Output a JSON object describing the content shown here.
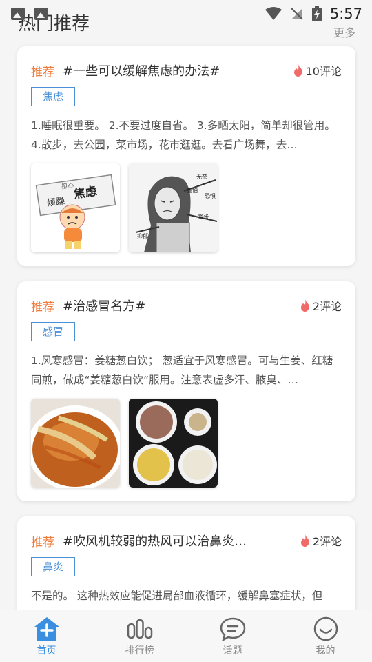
{
  "status_bar": {
    "time": "5:57"
  },
  "header": {
    "title": "热门推荐",
    "more": "更多"
  },
  "cards": [
    {
      "badge": "推荐",
      "topic": "#一些可以缓解焦虑的办法#",
      "comments": "10评论",
      "tag": "焦虑",
      "excerpt": "1.睡眠很重要。 2.不要过度自省。 3.多晒太阳，简单却很管用。 4.散步，去公园，菜市场，花市逛逛。去看广场舞，去…",
      "images": [
        {
          "lines": [
            "烦躁",
            "担心",
            "焦虑"
          ]
        },
        {
          "lines": [
            "抑郁",
            "紧张",
            "恐惧",
            "害怕",
            "无奈"
          ]
        }
      ]
    },
    {
      "badge": "推荐",
      "topic": "#治感冒名方#",
      "comments": "2评论",
      "tag": "感冒",
      "excerpt": "1.风寒感冒：姜糖葱白饮； 葱适宜于风寒感冒。可与生姜、红糖同煎，做成“姜糖葱白饮”服用。注意表虚多汗、腋臭、…"
    },
    {
      "badge": "推荐",
      "topic": "#吹风机较弱的热风可以治鼻炎…",
      "comments": "2评论",
      "tag": "鼻炎",
      "excerpt": "不是的。 这种热效应能促进局部血液循环，缓解鼻塞症状，但"
    }
  ],
  "nav": [
    {
      "label": "首页",
      "icon": "home-icon",
      "active": true
    },
    {
      "label": "排行榜",
      "icon": "ranking-icon",
      "active": false
    },
    {
      "label": "话题",
      "icon": "chat-icon",
      "active": false
    },
    {
      "label": "我的",
      "icon": "smiley-icon",
      "active": false
    }
  ],
  "colors": {
    "accent": "#3b8fe0",
    "badge": "#f07c3c",
    "tag": "#4a90d9",
    "flame": "#f06a6a"
  }
}
